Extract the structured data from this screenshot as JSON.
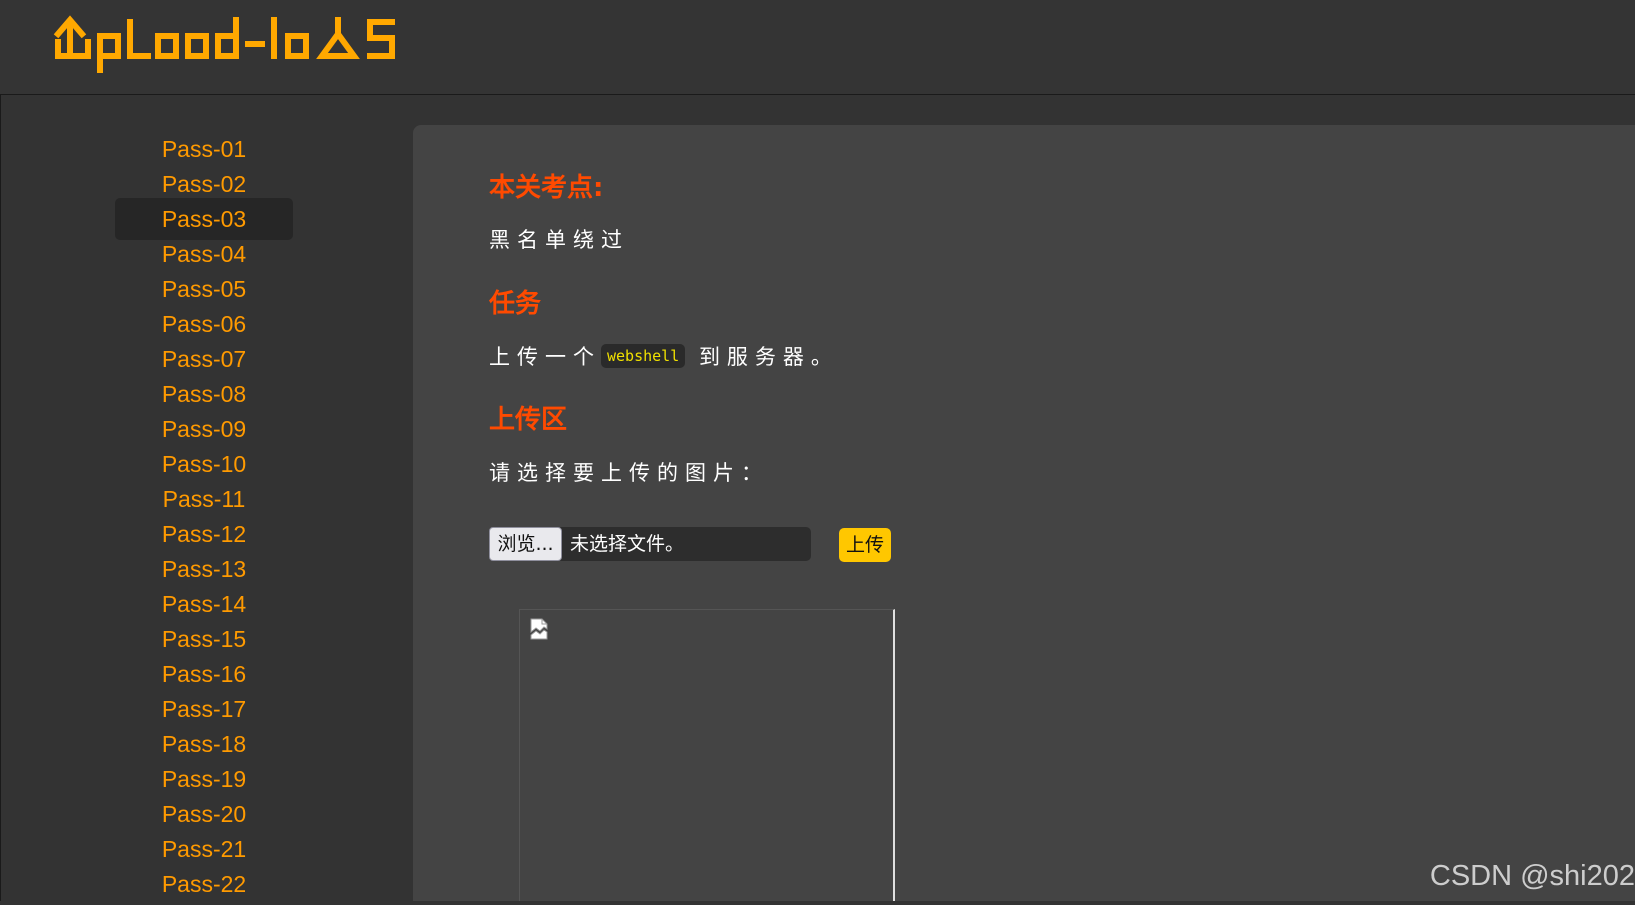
{
  "header": {
    "logo_text": "Upload-labs",
    "logo_color": "#ffa800"
  },
  "sidebar": {
    "active_index": 2,
    "items": [
      {
        "label": "Pass-01"
      },
      {
        "label": "Pass-02"
      },
      {
        "label": "Pass-03"
      },
      {
        "label": "Pass-04"
      },
      {
        "label": "Pass-05"
      },
      {
        "label": "Pass-06"
      },
      {
        "label": "Pass-07"
      },
      {
        "label": "Pass-08"
      },
      {
        "label": "Pass-09"
      },
      {
        "label": "Pass-10"
      },
      {
        "label": "Pass-11"
      },
      {
        "label": "Pass-12"
      },
      {
        "label": "Pass-13"
      },
      {
        "label": "Pass-14"
      },
      {
        "label": "Pass-15"
      },
      {
        "label": "Pass-16"
      },
      {
        "label": "Pass-17"
      },
      {
        "label": "Pass-18"
      },
      {
        "label": "Pass-19"
      },
      {
        "label": "Pass-20"
      },
      {
        "label": "Pass-21"
      },
      {
        "label": "Pass-22"
      }
    ]
  },
  "main": {
    "section1_heading": "本关考点:",
    "section1_text": "黑名单绕过",
    "section2_heading": "任务",
    "task_prefix": "上传一个",
    "task_code": "webshell",
    "task_suffix": "到服务器。",
    "section3_heading": "上传区",
    "upload_prompt": "请选择要上传的图片：",
    "browse_label": "浏览...",
    "file_status": "未选择文件。",
    "upload_label": "上传"
  },
  "colors": {
    "accent_orange": "#ff9a00",
    "heading_red": "#ff4a00",
    "upload_button": "#ffc700",
    "content_bg": "#444444"
  },
  "watermark": "CSDN @shi202"
}
